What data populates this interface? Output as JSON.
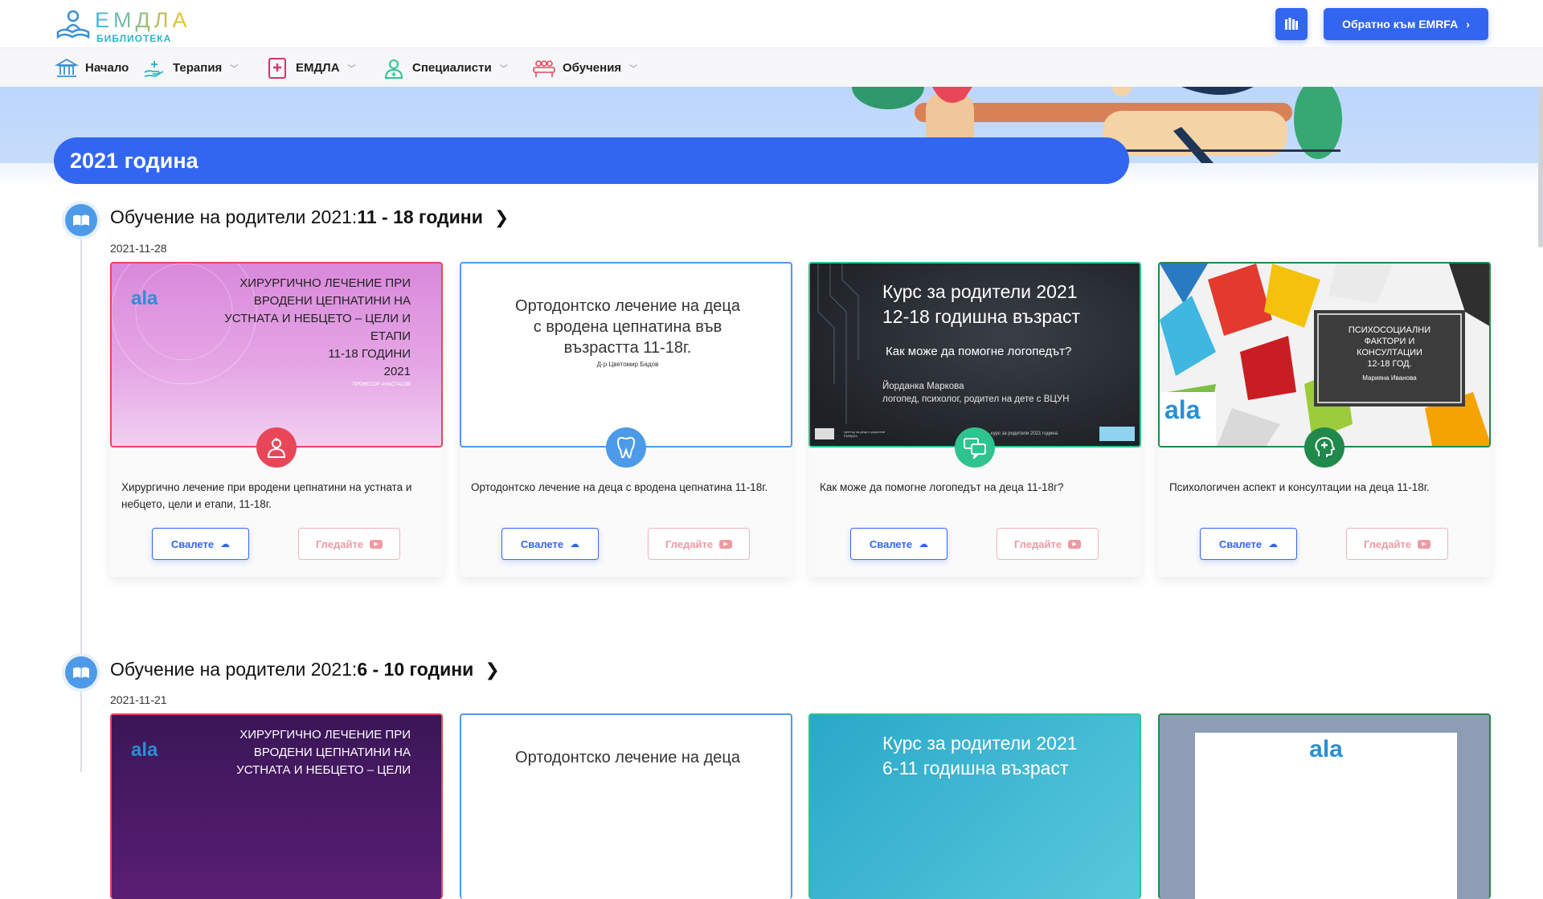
{
  "header": {
    "logo_title": "ЕМДЛА",
    "logo_subtitle": "БИБЛИОТЕКА",
    "back_button": "Обратно към EMRFA"
  },
  "nav": [
    {
      "label": "Начало",
      "icon": "bank-icon",
      "has_dropdown": false
    },
    {
      "label": "Терапия",
      "icon": "hand-heart-icon",
      "has_dropdown": true
    },
    {
      "label": "ЕМДЛА",
      "icon": "medical-book-icon",
      "has_dropdown": true
    },
    {
      "label": "Специалисти",
      "icon": "doctor-icon",
      "has_dropdown": true
    },
    {
      "label": "Обучения",
      "icon": "group-icon",
      "has_dropdown": true
    }
  ],
  "year_title": "2021 година",
  "sections": [
    {
      "title_prefix": "Обучение на родители 2021:",
      "title_bold": "11 - 18 години",
      "date": "2021-11-28",
      "cards": [
        {
          "title": "Хирургично лечение при вродени цепнатини на устната и небцето, цели и етапи, 11-18г.",
          "slide_lines": [
            "ХИРУРГИЧНО ЛЕЧЕНИЕ ПРИ",
            "ВРОДЕНИ ЦЕПНАТИНИ НА",
            "УСТНАТА И НЕБЦЕТО – ЦЕЛИ И",
            "ЕТАПИ",
            "11-18 ГОДИНИ",
            "2021"
          ],
          "slide_logo": "ala",
          "slide_author": "ПРОФЕСОР АНАСТАСОВ",
          "badge_icon": "doctor-icon",
          "color": "#e8475a"
        },
        {
          "title": "Ортодонтско лечение на деца с вродена цепнатина 11-18г.",
          "slide_lines": [
            "Ортодонтско лечение на деца",
            "с вродена цепнатина във",
            "възрастта 11-18г."
          ],
          "slide_author": "Д-р Цветомир Бадов",
          "badge_icon": "tooth-icon",
          "color": "#4d9ae8"
        },
        {
          "title": "Как може да помогне логопедът на деца 11-18г?",
          "slide_lines": [
            "Курс за родители 2021",
            "12-18 годишна възраст"
          ],
          "slide_sub": "Как може да помогне логопедът?",
          "slide_author_lines": [
            "Йорданка Маркова",
            "логопед, психолог, родител на дете с ВЦУН"
          ],
          "slide_footer_left": "Център за деца и родители ЕМФДЛА",
          "slide_footer_mid": "– курс за родители 2021 година",
          "badge_icon": "chat-icon",
          "color": "#2fc48d"
        },
        {
          "title": "Психологичен аспект и консултации на деца 11-18г.",
          "slide_lines": [
            "ПСИХОСОЦИАЛНИ",
            "ФАКТОРИ И",
            "КОНСУЛТАЦИИ",
            "12-18 ГОД."
          ],
          "slide_author": "Марияна Иванова",
          "slide_logo": "ala",
          "badge_icon": "head-cross-icon",
          "color": "#1f8a4c"
        }
      ]
    },
    {
      "title_prefix": "Обучение на родители 2021:",
      "title_bold": "6 - 10 години",
      "date": "2021-11-21",
      "cards": [
        {
          "slide_lines": [
            "ХИРУРГИЧНО ЛЕЧЕНИЕ ПРИ",
            "ВРОДЕНИ ЦЕПНАТИНИ НА",
            "УСТНАТА И НЕБЦЕТО – ЦЕЛИ"
          ],
          "slide_logo": "ala",
          "color": "#e8475a"
        },
        {
          "slide_lines": [
            "Ортодонтско лечение на деца"
          ],
          "color": "#4d9ae8"
        },
        {
          "slide_lines": [
            "Курс за родители 2021",
            "6-11 годишна възраст"
          ],
          "color": "#2fc48d"
        },
        {
          "slide_logo": "ala",
          "color": "#1f8a4c"
        }
      ]
    }
  ],
  "buttons": {
    "download": "Свалете",
    "watch": "Гледайте"
  },
  "colors": {
    "primary": "#3366f0",
    "banner": "#bcd6fb"
  }
}
